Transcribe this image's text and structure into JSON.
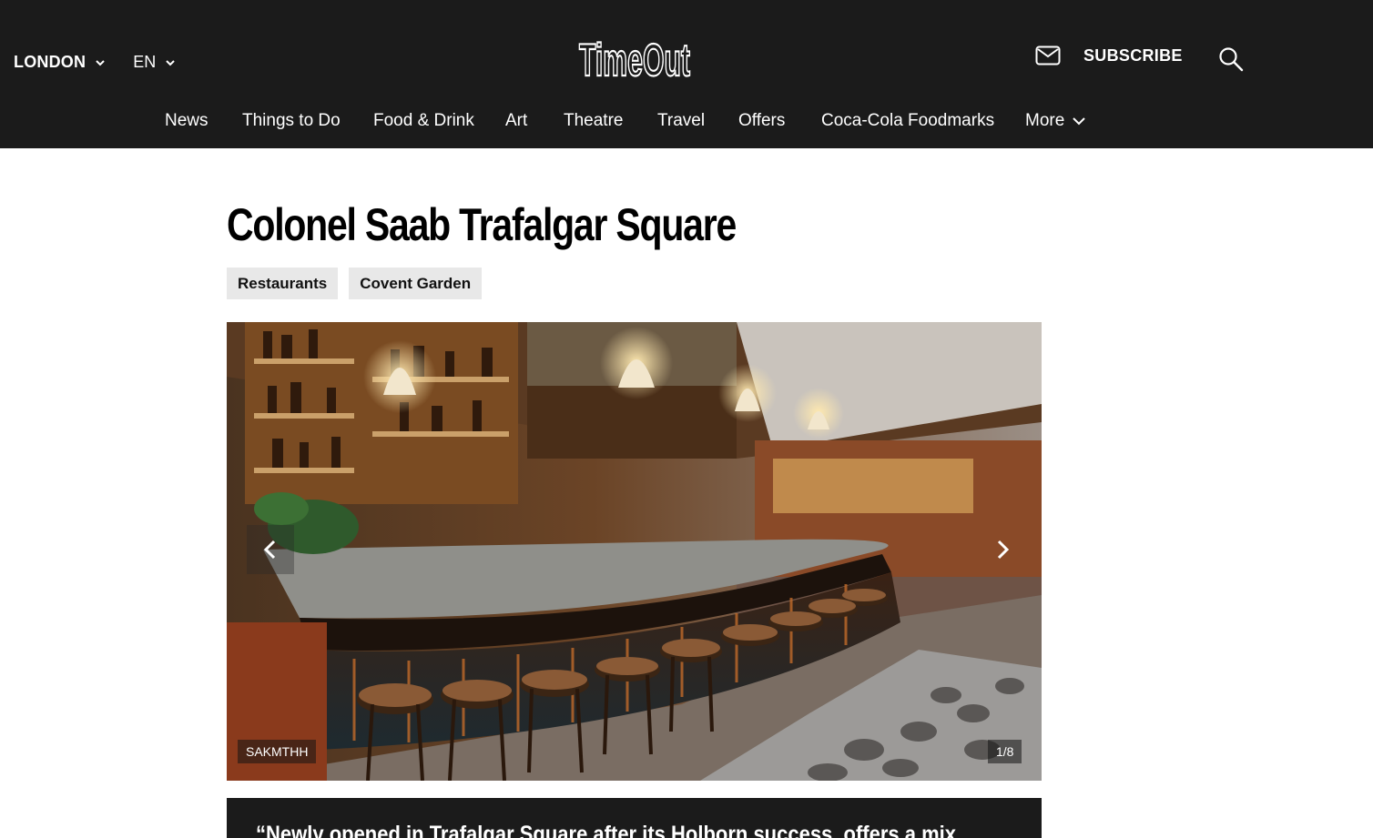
{
  "header": {
    "city": "LONDON",
    "language": "EN",
    "logo_text": "TimeOut",
    "subscribe_label": "SUBSCRIBE",
    "icons": [
      "chevron-down-icon",
      "mail-icon",
      "search-icon"
    ]
  },
  "nav": {
    "items": [
      "News",
      "Things to Do",
      "Food & Drink",
      "Art",
      "Theatre",
      "Travel",
      "Offers",
      "Coca-Cola Foodmarks",
      "More"
    ]
  },
  "article": {
    "title": "Colonel Saab Trafalgar Square",
    "tags": [
      "Restaurants",
      "Covent Garden"
    ]
  },
  "gallery": {
    "credit": "SAKMTHH",
    "counter": "1/8"
  },
  "quote": {
    "text": "“Newly opened in Trafalgar Square after its Holborn success, offers a mix"
  },
  "colors": {
    "header_bg": "#1b1b1b",
    "tag_bg": "#e8e8e8"
  }
}
